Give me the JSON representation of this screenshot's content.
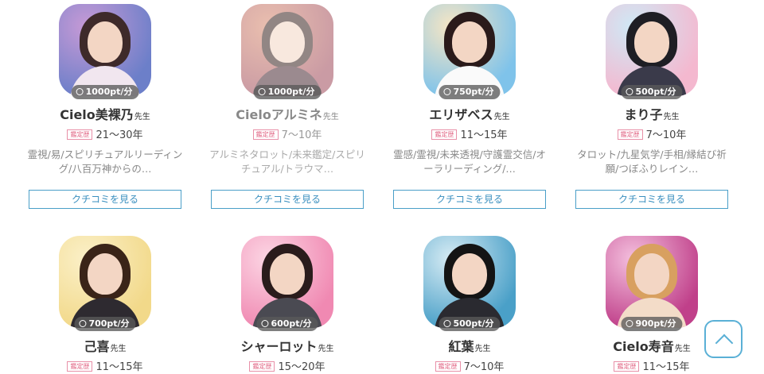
{
  "badge_label": "鑑定歴",
  "sensei_suffix": "先生",
  "review_button_label": "クチコミを見る",
  "fortune_tellers": [
    {
      "name": "Cielo美裸乃",
      "rate": "1000pt/分",
      "career": "21〜30年",
      "genres": "霊視/易/スピリチュアルリーディング/八百万神からの…",
      "status": "active",
      "photo_colors": [
        "#6c7fc9",
        "#c79ad6",
        "#3e2a2a",
        "#f1e6ef"
      ]
    },
    {
      "name": "Cieloアルミネ",
      "rate": "1000pt/分",
      "career": "7〜10年",
      "genres": "アルミネタロット/未来鑑定/スピリチュアル/トラウマ…",
      "status": "offline",
      "photo_colors": [
        "#a04a5a",
        "#d98b6e",
        "#3a2420",
        "#4a2c34"
      ]
    },
    {
      "name": "エリザベス",
      "rate": "750pt/分",
      "career": "11〜15年",
      "genres": "霊感/霊視/未来透視/守護霊交信/オーラリーディング/…",
      "status": "active",
      "photo_colors": [
        "#7fc3ea",
        "#f7e6c4",
        "#2a1a1a",
        "#fafafa"
      ]
    },
    {
      "name": "まり子",
      "rate": "500pt/分",
      "career": "7〜10年",
      "genres": "タロット/九星気学/手相/縁結び祈願/つぼふりレイン…",
      "status": "active",
      "photo_colors": [
        "#f4b8cf",
        "#cfe9f6",
        "#1e1e24",
        "#3a3a4a"
      ]
    },
    {
      "name": "己喜",
      "rate": "700pt/分",
      "career": "11〜15年",
      "genres": "",
      "status": "active",
      "photo_colors": [
        "#f2d98a",
        "#fbf0c8",
        "#3a2418",
        "#2e2a30"
      ]
    },
    {
      "name": "シャーロット",
      "rate": "600pt/分",
      "career": "15〜20年",
      "genres": "",
      "status": "active",
      "photo_colors": [
        "#f089b2",
        "#fcd6e4",
        "#2a1c1c",
        "#4a4a52"
      ]
    },
    {
      "name": "紅葉",
      "rate": "500pt/分",
      "career": "7〜10年",
      "genres": "",
      "status": "active",
      "photo_colors": [
        "#4aa0c8",
        "#d8ecf4",
        "#141414",
        "#2a2a30"
      ]
    },
    {
      "name": "Cielo寿音",
      "rate": "900pt/分",
      "career": "11〜15年",
      "genres": "",
      "status": "active",
      "photo_colors": [
        "#c0408a",
        "#f4c0de",
        "#d8a060",
        "#f3dcc8"
      ]
    }
  ]
}
